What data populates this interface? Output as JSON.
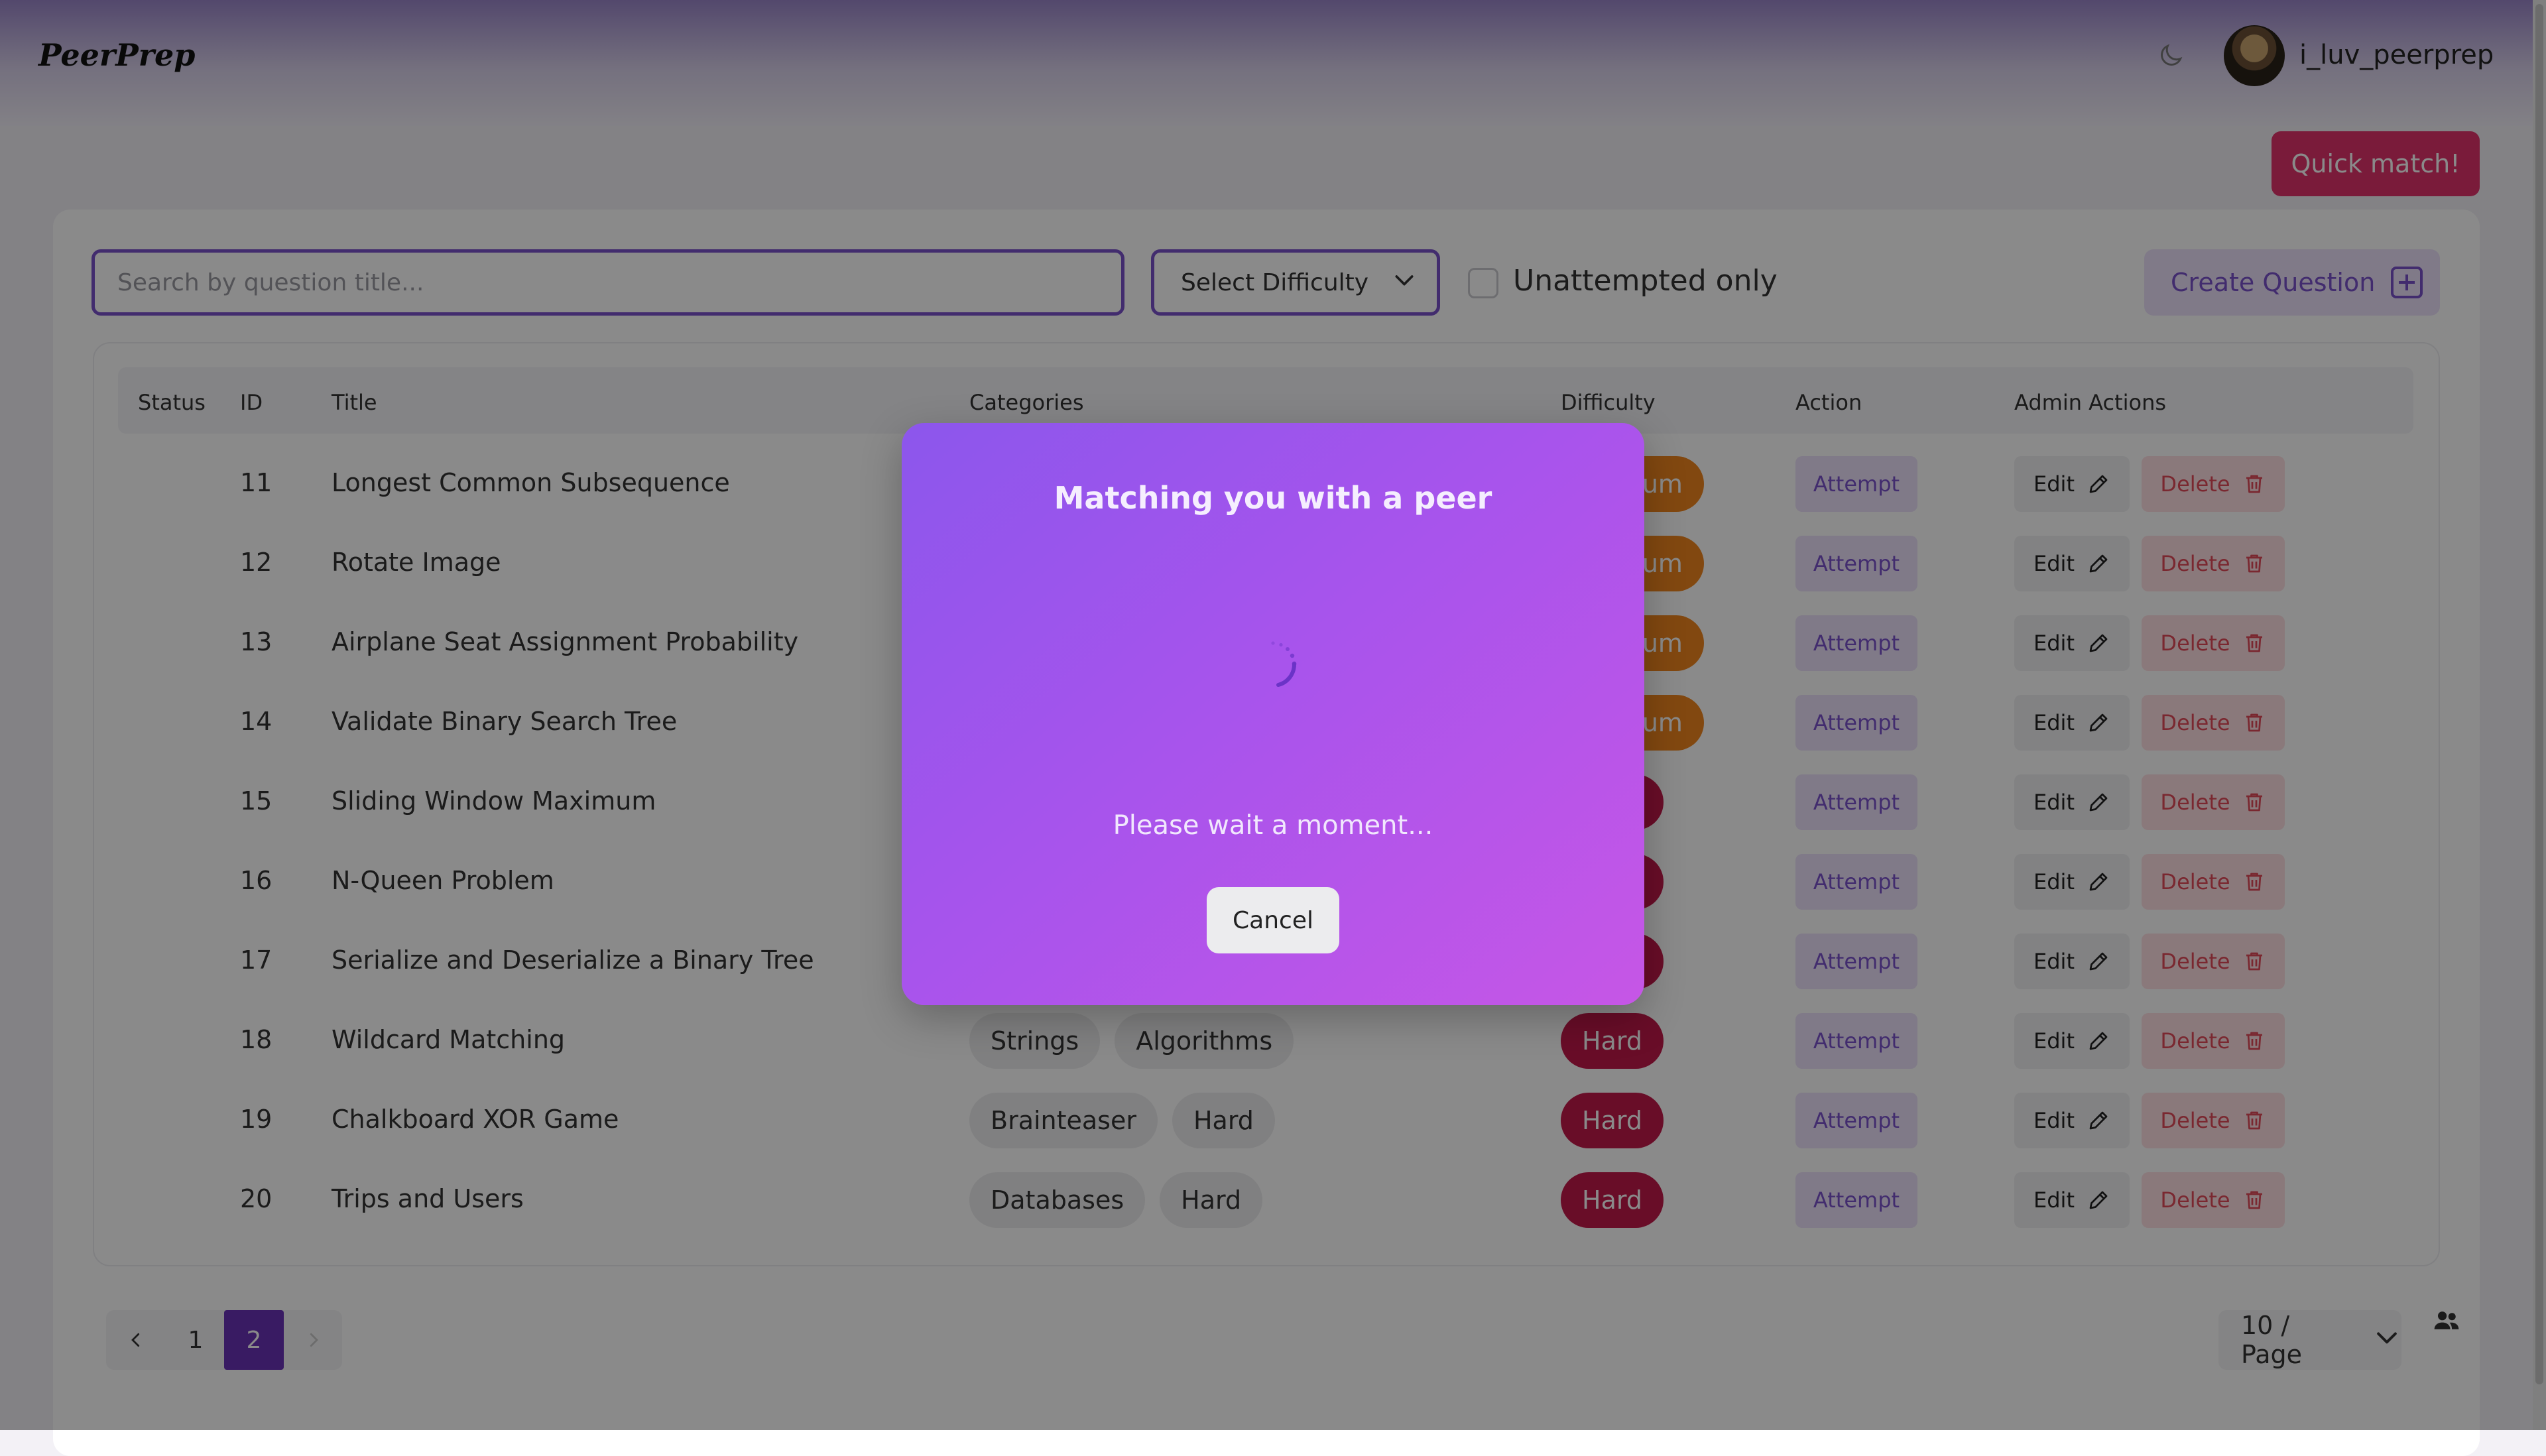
{
  "header": {
    "logo": "PeerPrep",
    "username": "i_luv_peerprep"
  },
  "quick_match_label": "Quick match!",
  "toolbar": {
    "search_placeholder": "Search by question title...",
    "difficulty_label": "Select Difficulty",
    "unattempted_label": "Unattempted only",
    "create_label": "Create Question"
  },
  "table": {
    "headers": [
      "Status",
      "ID",
      "Title",
      "Categories",
      "Difficulty",
      "Action",
      "Admin Actions"
    ],
    "rows": [
      {
        "id": "11",
        "title": "Longest Common Subsequence",
        "categories": [],
        "difficulty": "Medium"
      },
      {
        "id": "12",
        "title": "Rotate Image",
        "categories": [],
        "difficulty": "Medium"
      },
      {
        "id": "13",
        "title": "Airplane Seat Assignment Probability",
        "categories": [],
        "difficulty": "Medium"
      },
      {
        "id": "14",
        "title": "Validate Binary Search Tree",
        "categories": [],
        "difficulty": "Medium"
      },
      {
        "id": "15",
        "title": "Sliding Window Maximum",
        "categories": [],
        "difficulty": "Hard"
      },
      {
        "id": "16",
        "title": "N-Queen Problem",
        "categories": [],
        "difficulty": "Hard"
      },
      {
        "id": "17",
        "title": "Serialize and Deserialize a Binary Tree",
        "categories": [],
        "difficulty": "Hard"
      },
      {
        "id": "18",
        "title": "Wildcard Matching",
        "categories": [
          "Strings",
          "Algorithms"
        ],
        "difficulty": "Hard"
      },
      {
        "id": "19",
        "title": "Chalkboard XOR Game",
        "categories": [
          "Brainteaser",
          "Hard"
        ],
        "difficulty": "Hard"
      },
      {
        "id": "20",
        "title": "Trips and Users",
        "categories": [
          "Databases",
          "Hard"
        ],
        "difficulty": "Hard"
      }
    ],
    "attempt_label": "Attempt",
    "edit_label": "Edit",
    "delete_label": "Delete"
  },
  "pagination": {
    "pages": [
      "1",
      "2"
    ],
    "current": "2",
    "page_size": "10 / Page"
  },
  "modal": {
    "title": "Matching you with a peer",
    "wait_text": "Please wait a moment...",
    "cancel_label": "Cancel"
  },
  "colors": {
    "accent": "#7a52cc",
    "quick_match": "#e1336c",
    "medium": "#f0861e",
    "hard": "#c2194a",
    "modal_start": "#8c56ec",
    "modal_end": "#c656e6"
  }
}
